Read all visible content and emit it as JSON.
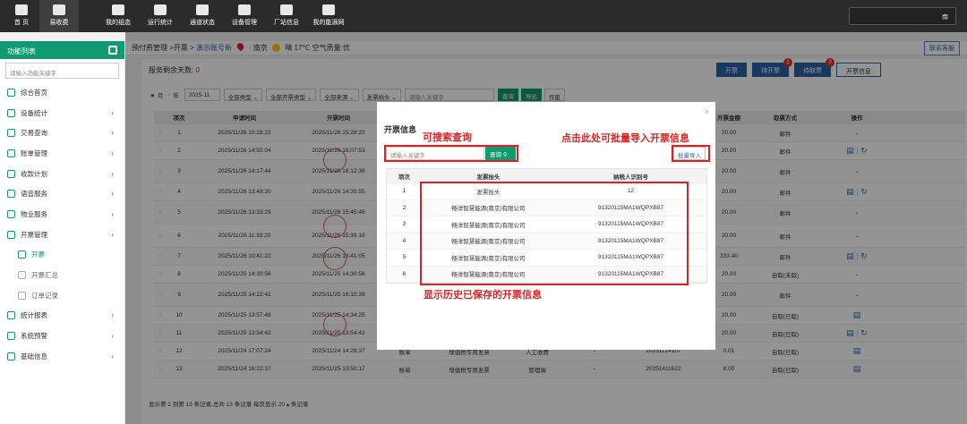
{
  "topnav": [
    {
      "label": "首 页",
      "icon": "home-icon"
    },
    {
      "label": "易收费",
      "icon": "user-card-icon",
      "active": true
    },
    {
      "label": "我的组态",
      "icon": "cube-icon"
    },
    {
      "label": "运行统计",
      "icon": "chart-icon"
    },
    {
      "label": "通道状态",
      "icon": "sliders-icon"
    },
    {
      "label": "设备管理",
      "icon": "org-icon"
    },
    {
      "label": "厂站信息",
      "icon": "building-icon"
    },
    {
      "label": "我的能源网",
      "icon": "person-icon"
    }
  ],
  "top_right_text": "南",
  "sidebar": {
    "title": "功能列表",
    "search_placeholder": "请输入功能关键字",
    "items": [
      {
        "label": "综合首页",
        "sub": false,
        "arrow": ""
      },
      {
        "label": "设备统计",
        "sub": false,
        "arrow": "›"
      },
      {
        "label": "交易查询",
        "sub": false,
        "arrow": "›"
      },
      {
        "label": "账单管理",
        "sub": false,
        "arrow": "›"
      },
      {
        "label": "收款计划",
        "sub": false,
        "arrow": "›"
      },
      {
        "label": "语音服务",
        "sub": false,
        "arrow": "›"
      },
      {
        "label": "物业服务",
        "sub": false,
        "arrow": "›"
      },
      {
        "label": "开票管理",
        "sub": false,
        "arrow": "›"
      },
      {
        "label": "开票",
        "sub": true,
        "active": true,
        "arrow": ""
      },
      {
        "label": "开票汇总",
        "sub": true,
        "arrow": ""
      },
      {
        "label": "订单记录",
        "sub": true,
        "arrow": ""
      },
      {
        "label": "统计报表",
        "sub": false,
        "arrow": "›"
      },
      {
        "label": "系统预警",
        "sub": false,
        "arrow": "›"
      },
      {
        "label": "基础信息",
        "sub": false,
        "arrow": "›"
      }
    ]
  },
  "breadcrumb": {
    "part1": "预付费管理 >开票 >",
    "part2": "演示账号新",
    "city": "南京",
    "weather": "晴 17℃ 空气质量:优"
  },
  "contact_button": "联系客服",
  "main": {
    "days_label": "服务剩余天数:",
    "days_value": "0",
    "buttons": [
      {
        "label": "开票",
        "badge": ""
      },
      {
        "label": "待开票",
        "badge": "1"
      },
      {
        "label": "待取票",
        "badge": "3"
      },
      {
        "label": "开票信息",
        "badge": "",
        "outline": true
      }
    ],
    "filters": {
      "month": "月",
      "year": "年",
      "date": "2025-11",
      "sel1": "全部类型",
      "sel2": "全部开票类型",
      "sel3": "全部来源",
      "sel4": "发票抬头",
      "keyword_placeholder": "请输入关键字",
      "btn_query": "查询",
      "btn_export": "导出",
      "btn_void": "作废"
    },
    "table": {
      "headers": [
        "",
        "项次",
        "申请时间",
        "开票时间",
        "",
        "",
        "",
        "",
        "",
        "开票金额",
        "取票方式",
        "操作"
      ],
      "rows": [
        {
          "no": "1",
          "apply": "2025/11/26 15:28:22",
          "issue": "2025/11/26 15:28:22",
          "c4": "",
          "c5": "",
          "c6": "",
          "c7": "",
          "c8": "",
          "amount": "20.00",
          "method": "邮件",
          "op": "-",
          "tall": false
        },
        {
          "no": "2",
          "apply": "2025/11/26 14:50:04",
          "issue": "2025/11/26 16:07:53",
          "c4": "",
          "c5": "",
          "c6": "",
          "c7": "",
          "c8": "",
          "amount": "20.00",
          "method": "邮件",
          "op": "icons",
          "tall": false
        },
        {
          "no": "3",
          "apply": "2025/11/26 14:17:44",
          "issue": "2025/11/26 16:12:39",
          "c4": "",
          "c5": "",
          "c6": "",
          "c7": "",
          "c8": "",
          "amount": "20.00",
          "method": "邮件",
          "op": "-",
          "tall": true
        },
        {
          "no": "4",
          "apply": "2025/11/26 13:49:20",
          "issue": "2025/11/26 14:35:55",
          "c4": "",
          "c5": "",
          "c6": "",
          "c7": "",
          "c8": "",
          "amount": "20.00",
          "method": "邮件",
          "op": "icons",
          "tall": false
        },
        {
          "no": "5",
          "apply": "2025/11/26 13:33:29",
          "issue": "2025/11/26 15:45:46",
          "c4": "",
          "c5": "",
          "c6": "",
          "c7": "",
          "c8": "",
          "amount": "20.00",
          "method": "邮件",
          "op": "-",
          "tall": true
        },
        {
          "no": "6",
          "apply": "2025/11/26 11:33:20",
          "issue": "2025/11/26 15:39:18",
          "c4": "",
          "c5": "",
          "c6": "",
          "c7": "",
          "c8": "",
          "amount": "20.00",
          "method": "邮件",
          "op": "-",
          "tall": true
        },
        {
          "no": "7",
          "apply": "2025/11/26 10:41:22",
          "issue": "2025/11/26 13:41:05",
          "c4": "",
          "c5": "",
          "c6": "",
          "c7": "",
          "c8": "",
          "amount": "333.40",
          "method": "邮件",
          "op": "icons",
          "tall": false
        },
        {
          "no": "8",
          "apply": "2025/11/25 14:30:56",
          "issue": "2025/11/25 14:30:56",
          "c4": "",
          "c5": "",
          "c6": "",
          "c7": "",
          "c8": "",
          "amount": "20.00",
          "method": "自取(未取)",
          "op": "-",
          "tall": false
        },
        {
          "no": "9",
          "apply": "2025/11/25 14:22:41",
          "issue": "2025/11/25 16:10:39",
          "c4": "",
          "c5": "",
          "c6": "",
          "c7": "",
          "c8": "",
          "amount": "20.00",
          "method": "邮件",
          "op": "-",
          "tall": true
        },
        {
          "no": "10",
          "apply": "2025/11/25 13:57:48",
          "issue": "2025/11/25 14:34:25",
          "c4": "",
          "c5": "",
          "c6": "",
          "c7": "",
          "c8": "",
          "amount": "20.00",
          "method": "自取(已取)",
          "op": "icon1",
          "tall": false
        },
        {
          "no": "11",
          "apply": "2025/11/25 13:54:42",
          "issue": "2025/11/25 13:54:42",
          "c4": "",
          "c5": "",
          "c6": "",
          "c7": "",
          "c8": "",
          "amount": "20.00",
          "method": "自取(已取)",
          "op": "icons",
          "tall": false
        },
        {
          "no": "12",
          "apply": "2025/11/24 17:07:24",
          "issue": "2025/11/24 14:26:37",
          "c4": "账单",
          "c5": "增值税专用发票",
          "c6": "人工收费",
          "c7": "-",
          "c8": "20251124107",
          "amount": "0.01",
          "method": "自取(已取)",
          "op": "icon1",
          "tall": false
        },
        {
          "no": "13",
          "apply": "2025/11/24 16:22:37",
          "issue": "2025/11/25 13:50:17",
          "c4": "账单",
          "c5": "增值税专用发票",
          "c6": "管理端",
          "c7": "-",
          "c8": "20251411622",
          "amount": "8.00",
          "method": "自取(已取)",
          "op": "icon1",
          "tall": false
        }
      ]
    },
    "pagination": "显示第 1 到第 13 条记录,总共 13 条记录 每页显示 20 ▴ 条记录"
  },
  "modal": {
    "title": "开票信息",
    "close": "×",
    "search_placeholder": "请输入关键字",
    "search_btn": "查询",
    "import_btn": "批量导入",
    "headers": [
      "项次",
      "发票抬头",
      "纳税人识别号"
    ],
    "rows": [
      {
        "no": "1",
        "title": "发票抬头",
        "tax": "12"
      },
      {
        "no": "2",
        "title": "畅洋智慧能源(南京)有限公司",
        "tax": "91320115MA1WQPXB87"
      },
      {
        "no": "3",
        "title": "畅洋智慧能源(南京)有限公司",
        "tax": "91320115MA1WQPXB87"
      },
      {
        "no": "4",
        "title": "畅洋智慧能源(南京)有限公司",
        "tax": "91320115MA1WQPXB87"
      },
      {
        "no": "5",
        "title": "畅洋智慧能源(南京)有限公司",
        "tax": "91320115MA1WQPXB87"
      },
      {
        "no": "6",
        "title": "畅洋智慧能源(南京)有限公司",
        "tax": "91320115MA1WQPXB87"
      }
    ]
  },
  "annotations": {
    "search": "可搜索查询",
    "import": "点击此处可批量导入开票信息",
    "history": "显示历史已保存的开票信息"
  },
  "colors": {
    "accent": "#0f9a6f",
    "primary": "#2a5fa8",
    "annotation": "#e02020"
  }
}
